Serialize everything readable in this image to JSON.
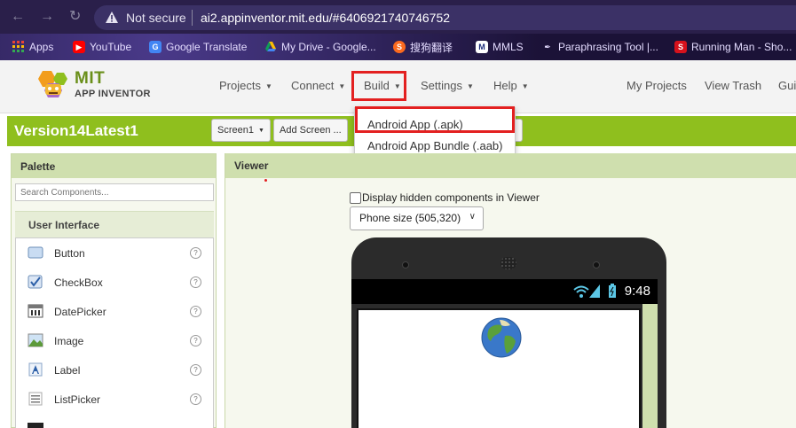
{
  "browser": {
    "security_label": "Not secure",
    "url": "ai2.appinventor.mit.edu/#6406921740746752",
    "bookmarks": [
      {
        "label": "Apps",
        "icon": "apps-grid-icon"
      },
      {
        "label": "YouTube",
        "icon": "youtube-icon"
      },
      {
        "label": "Google Translate",
        "icon": "google-translate-icon"
      },
      {
        "label": "My Drive - Google...",
        "icon": "google-drive-icon"
      },
      {
        "label": "搜狗翻译",
        "icon": "sogou-icon"
      },
      {
        "label": "MMLS",
        "icon": "mmls-icon"
      },
      {
        "label": "Paraphrasing Tool |...",
        "icon": "quill-icon"
      },
      {
        "label": "Running Man - Sho...",
        "icon": "running-man-icon"
      }
    ]
  },
  "app": {
    "logo_title": "MIT",
    "logo_subtitle": "APP INVENTOR",
    "menu": {
      "projects": "Projects",
      "connect": "Connect",
      "build": "Build",
      "settings": "Settings",
      "help": "Help",
      "my_projects": "My Projects",
      "view_trash": "View Trash",
      "guide": "Gui"
    },
    "build_menu": {
      "items": [
        "Android App (.apk)",
        "Android App Bundle (.aab)"
      ]
    },
    "project": {
      "name": "Version14Latest1",
      "screen_button": "Screen1",
      "add_screen_button": "Add Screen ..."
    },
    "palette": {
      "title": "Palette",
      "search_placeholder": "Search Components...",
      "category": "User Interface",
      "components": [
        {
          "label": "Button",
          "icon": "button-component-icon"
        },
        {
          "label": "CheckBox",
          "icon": "checkbox-component-icon"
        },
        {
          "label": "DatePicker",
          "icon": "datepicker-component-icon"
        },
        {
          "label": "Image",
          "icon": "image-component-icon"
        },
        {
          "label": "Label",
          "icon": "label-component-icon"
        },
        {
          "label": "ListPicker",
          "icon": "listpicker-component-icon"
        }
      ],
      "help_glyph": "?"
    },
    "viewer": {
      "title": "Viewer",
      "hidden_components_label": "Display hidden components in Viewer",
      "phone_size_selected": "Phone size (505,320)",
      "status_time": "9:48"
    }
  },
  "colors": {
    "accent_green": "#8fbf1e",
    "panel_header": "#cfdfae",
    "highlight_red": "#e32020",
    "browser_bar": "#2a1f4a"
  }
}
